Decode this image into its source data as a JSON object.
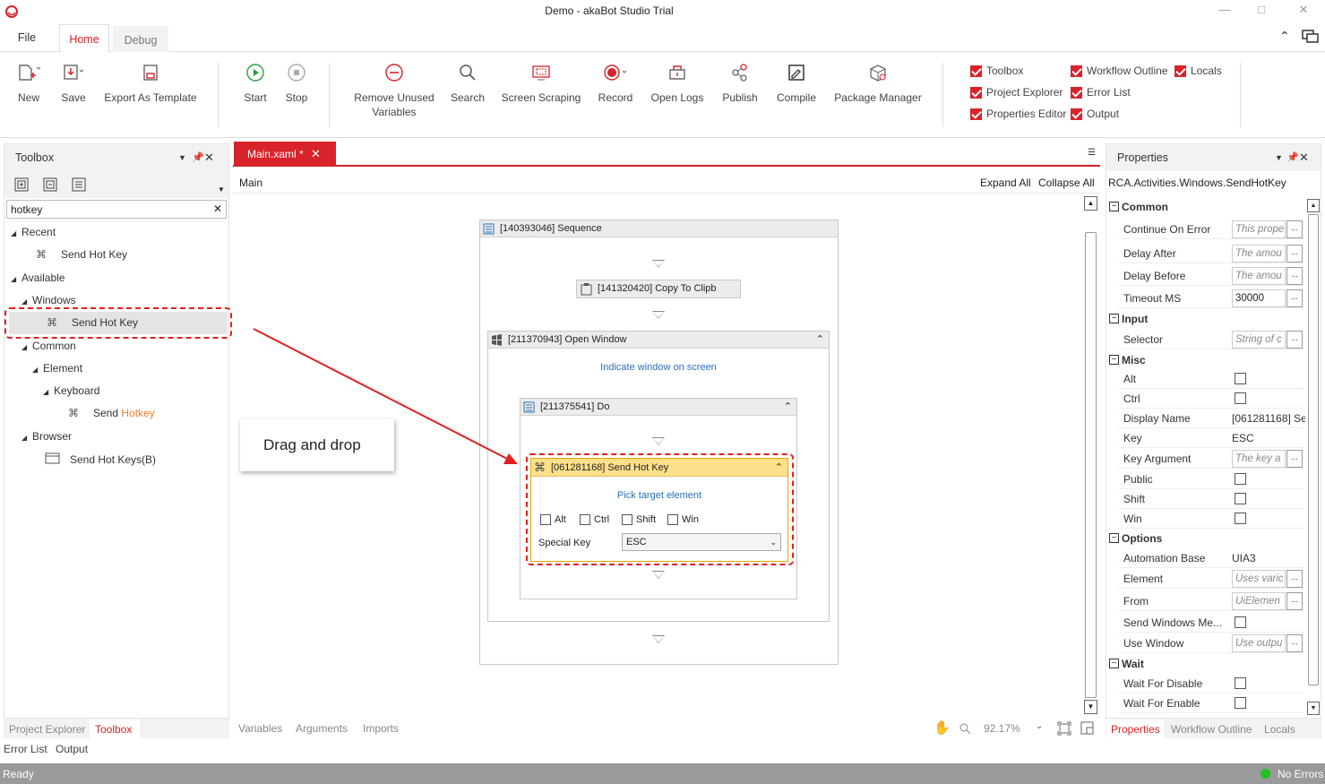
{
  "window": {
    "title": "Demo - akaBot Studio Trial"
  },
  "tabs": [
    {
      "label": "File"
    },
    {
      "label": "Home"
    },
    {
      "label": "Debug"
    }
  ],
  "ribbon": {
    "new": "New",
    "save": "Save",
    "export": "Export As Template",
    "start": "Start",
    "stop": "Stop",
    "remove_unused_1": "Remove Unused",
    "remove_unused_2": "Variables",
    "search": "Search",
    "screen_scraping": "Screen Scraping",
    "record": "Record",
    "open_logs": "Open Logs",
    "publish": "Publish",
    "compile": "Compile",
    "package_manager": "Package Manager",
    "checks": {
      "toolbox": "Toolbox",
      "project_explorer": "Project Explorer",
      "properties_editor": "Properties Editor",
      "workflow_outline": "Workflow Outline",
      "error_list": "Error List",
      "output": "Output",
      "locals": "Locals"
    }
  },
  "toolbox": {
    "title": "Toolbox",
    "search_value": "hotkey",
    "recent": "Recent",
    "recent_item": "Send Hot Key",
    "available": "Available",
    "windows": "Windows",
    "windows_item": "Send Hot Key",
    "common": "Common",
    "element": "Element",
    "keyboard": "Keyboard",
    "send_prefix": "Send ",
    "send_highlight": "Hotkey",
    "browser": "Browser",
    "browser_item": "Send Hot Keys(B)"
  },
  "callout": {
    "text": "Drag and drop"
  },
  "editor": {
    "tab": "Main.xaml *",
    "breadcrumb": "Main",
    "expand_all": "Expand All",
    "collapse_all": "Collapse All",
    "sequence": "[140393046] Sequence",
    "copy": "[141320420] Copy To Clipb",
    "open_window": "[211370943] Open Window",
    "indicate": "Indicate window on screen",
    "do": "[211375541] Do",
    "send_hot_key": "[061281168] Send Hot Key",
    "pick_target": "Pick target element",
    "alt": "Alt",
    "ctrl": "Ctrl",
    "shift": "Shift",
    "win": "Win",
    "special_key_label": "Special Key",
    "special_key_value": "ESC"
  },
  "editor_bottom": {
    "variables": "Variables",
    "arguments": "Arguments",
    "imports": "Imports",
    "zoom": "92.17%"
  },
  "properties": {
    "title": "Properties",
    "type": "RCA.Activities.Windows.SendHotKey",
    "cats": {
      "common": "Common",
      "input": "Input",
      "misc": "Misc",
      "options": "Options",
      "wait": "Wait"
    },
    "continue_on_error": "Continue On Error",
    "continue_on_error_v": "This prope",
    "delay_after": "Delay After",
    "delay_after_v": "The amou",
    "delay_before": "Delay Before",
    "delay_before_v": "The amou",
    "timeout": "Timeout MS",
    "timeout_v": "30000",
    "selector": "Selector",
    "selector_v": "String of c",
    "alt": "Alt",
    "ctrl": "Ctrl",
    "display_name": "Display Name",
    "display_name_v": "[061281168] Se",
    "key": "Key",
    "key_v": "ESC",
    "key_argument": "Key Argument",
    "key_argument_v": "The key a",
    "public": "Public",
    "shift": "Shift",
    "win": "Win",
    "automation_base": "Automation Base",
    "automation_base_v": "UIA3",
    "element": "Element",
    "element_v": "Uses varic",
    "from": "From",
    "from_v": "UiElemen",
    "send_windows_me": "Send Windows Me...",
    "use_window": "Use Window",
    "use_window_v": "Use outpu",
    "wait_for_disable": "Wait For Disable",
    "wait_for_enable": "Wait For Enable",
    "ellipsis": "..."
  },
  "bottom_left_tabs": {
    "project_explorer": "Project Explorer",
    "toolbox": "Toolbox",
    "error_list": "Error List",
    "output": "Output"
  },
  "bottom_right_tabs": {
    "properties": "Properties",
    "workflow_outline": "Workflow Outline",
    "locals": "Locals"
  },
  "status": {
    "left": "Ready",
    "right": "No Errors"
  },
  "colors": {
    "accent": "#d9232a",
    "highlight": "#f08030",
    "status_green": "#1fc11f"
  }
}
